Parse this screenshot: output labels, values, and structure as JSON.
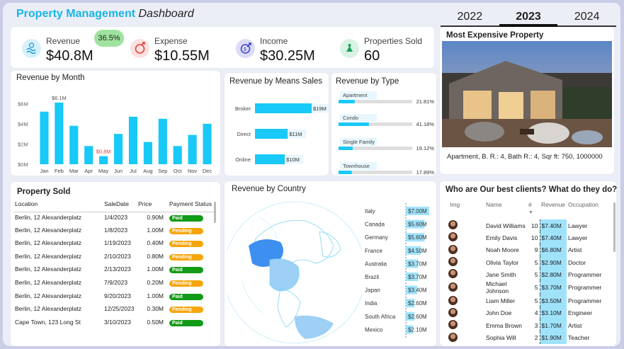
{
  "header": {
    "title_main": "Property Management",
    "title_sub": "Dashboard"
  },
  "years": [
    {
      "label": "2022"
    },
    {
      "label": "2023"
    },
    {
      "label": "2024"
    }
  ],
  "kpis": {
    "revenue": {
      "label": "Revenue",
      "value": "$40.8M"
    },
    "expense_pct": "36.5%",
    "expense": {
      "label": "Expense",
      "value": "$10.55M"
    },
    "income": {
      "label": "Income",
      "value": "$30.25M"
    },
    "properties_sold": {
      "label": "Properties Sold",
      "value": "60"
    }
  },
  "revenue_by_month": {
    "title": "Revenue by Month",
    "chart_data": {
      "type": "bar",
      "categories": [
        "Jan",
        "Feb",
        "Mar",
        "Apr",
        "May",
        "Jun",
        "Jul",
        "Aug",
        "Sep",
        "Oct",
        "Nov",
        "Dec"
      ],
      "values": [
        5.2,
        6.1,
        3.8,
        1.8,
        0.8,
        3.0,
        4.7,
        2.2,
        4.5,
        1.8,
        2.9,
        4.0
      ],
      "yticks": [
        "$0M",
        "$2M",
        "$4M",
        "$6M"
      ],
      "ylim": [
        0,
        7
      ],
      "annotations": [
        {
          "index": 1,
          "text": "$6.1M",
          "color": "#555555"
        },
        {
          "index": 4,
          "text": "$0.8M",
          "color": "#e53935"
        }
      ],
      "color": "#19c9f7"
    }
  },
  "revenue_by_means": {
    "title": "Revenue by Means Sales",
    "chart_data": {
      "type": "bar",
      "orientation": "horizontal",
      "categories": [
        "Broker",
        "Direct",
        "Online"
      ],
      "values": [
        19,
        11,
        10
      ],
      "labels": [
        "$19M",
        "$11M",
        "$10M"
      ],
      "color": "#19c9f7"
    }
  },
  "revenue_by_type": {
    "title": "Revenue by Type",
    "chart_data": {
      "type": "bar",
      "orientation": "horizontal",
      "categories": [
        "Apartment",
        "Condo",
        "Single Family",
        "Townhouse"
      ],
      "values": [
        21.81,
        41.18,
        19.12,
        17.89
      ],
      "labels": [
        "21.81%",
        "41.18%",
        "19.12%",
        "17.89%"
      ],
      "color": "#19c9f7"
    }
  },
  "most_expensive": {
    "title": "Most Expensive Property",
    "caption": "Apartment, B. R.: 4, Bath R.: 4, Sqr ft: 750, 1000000"
  },
  "property_sold": {
    "title": "Property Sold",
    "columns": [
      "Location",
      "SaleDate",
      "Price",
      "Payment Status"
    ],
    "rows": [
      {
        "location": "Berlin, 12 Alexanderplatz",
        "date": "1/4/2023",
        "price": "0.90M",
        "status": "Paid"
      },
      {
        "location": "Berlin, 12 Alexanderplatz",
        "date": "1/8/2023",
        "price": "1.00M",
        "status": "Pending"
      },
      {
        "location": "Berlin, 12 Alexanderplatz",
        "date": "1/19/2023",
        "price": "0.40M",
        "status": "Pending"
      },
      {
        "location": "Berlin, 12 Alexanderplatz",
        "date": "2/10/2023",
        "price": "0.80M",
        "status": "Pending"
      },
      {
        "location": "Berlin, 12 Alexanderplatz",
        "date": "2/13/2023",
        "price": "1.00M",
        "status": "Paid"
      },
      {
        "location": "Berlin, 12 Alexanderplatz",
        "date": "7/9/2023",
        "price": "0.20M",
        "status": "Pending"
      },
      {
        "location": "Berlin, 12 Alexanderplatz",
        "date": "9/20/2023",
        "price": "1.00M",
        "status": "Paid"
      },
      {
        "location": "Berlin, 12 Alexanderplatz",
        "date": "12/25/2023",
        "price": "0.30M",
        "status": "Pending"
      },
      {
        "location": "Cape Town, 123 Long St",
        "date": "3/10/2023",
        "price": "0.50M",
        "status": "Paid"
      }
    ]
  },
  "revenue_by_country": {
    "title": "Revenue by Country",
    "chart_data": {
      "type": "bar",
      "orientation": "horizontal",
      "categories": [
        "Italy",
        "Canada",
        "Germany",
        "France",
        "Australia",
        "Brazil",
        "Japan",
        "India",
        "South Africa",
        "Mexico"
      ],
      "values": [
        7.0,
        5.6,
        5.6,
        4.5,
        3.7,
        3.7,
        3.4,
        2.6,
        2.6,
        2.1
      ],
      "labels": [
        "$7.00M",
        "$5.60M",
        "$5.60M",
        "$4.50M",
        "$3.70M",
        "$3.70M",
        "$3.40M",
        "$2.60M",
        "$2.60M",
        "$2.10M"
      ],
      "color": "#9fe3fb"
    }
  },
  "best_clients": {
    "title": "Who are Our best clients? What do they do?",
    "columns": [
      "Img",
      "Name",
      "#",
      "Revenue",
      "Occupation"
    ],
    "rows": [
      {
        "name": "David Williams",
        "count": "10",
        "revenue": "$7.40M",
        "occupation": "Lawyer"
      },
      {
        "name": "Emily Davis",
        "count": "10",
        "revenue": "$7.40M",
        "occupation": "Lawyer"
      },
      {
        "name": "Noah Moore",
        "count": "9",
        "revenue": "$6.80M",
        "occupation": "Artist"
      },
      {
        "name": "Olivia Taylor",
        "count": "5",
        "revenue": "$2.90M",
        "occupation": "Doctor"
      },
      {
        "name": "Jane Smith",
        "count": "5",
        "revenue": "$2.80M",
        "occupation": "Programmer"
      },
      {
        "name": "Michael Johnson",
        "count": "5",
        "revenue": "$3.70M",
        "occupation": "Programmer"
      },
      {
        "name": "Liam Miller",
        "count": "5",
        "revenue": "$3.50M",
        "occupation": "Programmer"
      },
      {
        "name": "John Doe",
        "count": "4",
        "revenue": "$3.10M",
        "occupation": "Engineer"
      },
      {
        "name": "Emma Brown",
        "count": "3",
        "revenue": "$1.70M",
        "occupation": "Artist"
      },
      {
        "name": "Sophia Will",
        "count": "2",
        "revenue": "$1.90M",
        "occupation": "Teacher"
      }
    ]
  },
  "colors": {
    "accent": "#17b6e6",
    "bar": "#19c9f7",
    "paid": "#129b16",
    "pending": "#f5a60b"
  }
}
